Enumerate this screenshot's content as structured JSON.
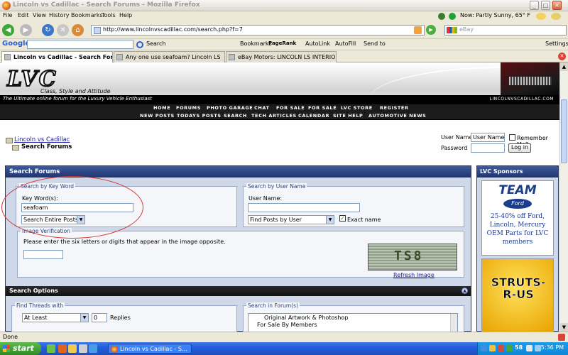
{
  "browser": {
    "title": "Lincoln vs Cadillac - Search Forums - Mozilla Firefox",
    "menu": [
      "File",
      "Edit",
      "View",
      "History",
      "Bookmarks",
      "Tools",
      "Help"
    ],
    "weather": "Now: Partly Sunny, 65° F",
    "url": "http://www.lincolnvscadillac.com/search.php?f=7",
    "search_placeholder": "eBay",
    "google_toolbar": {
      "logo": "Google",
      "items": [
        "Search",
        "Bookmarks",
        "PageRank",
        "AutoLink",
        "AutoFill",
        "Send to",
        "Settings"
      ]
    },
    "tabs": [
      {
        "label": "Lincoln vs Cadillac - Search Forums",
        "active": true
      },
      {
        "label": "Any one use seafoam? Lincoln LS",
        "active": false
      },
      {
        "label": "eBay Motors: LINCOLN LS INTERIOR ...",
        "active": false
      }
    ],
    "status": "Done"
  },
  "site": {
    "logo": "LVC",
    "tagline": "Class, Style and Attitude",
    "subtitle": "The Ultimate online forum for the Luxury Vehicle Enthusiast",
    "domain": "LINCOLNVSCADILLAC.COM",
    "nav_row1": [
      "HOME",
      "FORUMS",
      "PHOTO GARAGE",
      "CHAT",
      "FOR SALE",
      "FOR SALE",
      "LVC STORE",
      "REGISTER"
    ],
    "nav_row2": [
      "NEW POSTS",
      "TODAYS POSTS",
      "SEARCH",
      "TECH ARTICLES",
      "CALENDAR",
      "SITE HELP",
      "AUTOMOTIVE NEWS"
    ]
  },
  "breadcrumb": {
    "home": "Lincoln vs Cadillac",
    "current": "Search Forums"
  },
  "login": {
    "username_label": "User Name",
    "username_value": "User Name",
    "remember_label": "Remember Me?",
    "password_label": "Password",
    "login_button": "Log in"
  },
  "search_forums": {
    "heading": "Search Forums",
    "keyword": {
      "legend": "Search by Key Word",
      "label": "Key Word(s):",
      "value": "seafoam",
      "mode": "Search Entire Posts"
    },
    "user": {
      "legend": "Search by User Name",
      "label": "User Name:",
      "value": "",
      "mode": "Find Posts by User",
      "exact_label": "Exact name"
    },
    "verification": {
      "legend": "Image Verification",
      "text": "Please enter the six letters or digits that appear in the image opposite.",
      "captcha": "TS8",
      "refresh": "Refresh Image"
    },
    "options": {
      "heading": "Search Options",
      "threads_legend": "Find Threads with",
      "threads_mode": "At Least",
      "replies_value": "0",
      "replies_label": "Replies",
      "forums_legend": "Search in Forum(s)",
      "forums_list": [
        "Original Artwork & Photoshop",
        "For Sale By Members"
      ]
    }
  },
  "sponsors": {
    "heading": "LVC Sponsors",
    "ad1_brand": "TEAM",
    "ad1_oval": "Ford",
    "ad1_text": "25-40% off Ford, Lincoln, Mercury OEM Parts for LVC members",
    "ad2_text": "STRUTS-R-US"
  },
  "taskbar": {
    "start": "start",
    "window": "Lincoln vs Cadillac - S...",
    "clock": "5:36 PM",
    "tray_number": "58"
  }
}
